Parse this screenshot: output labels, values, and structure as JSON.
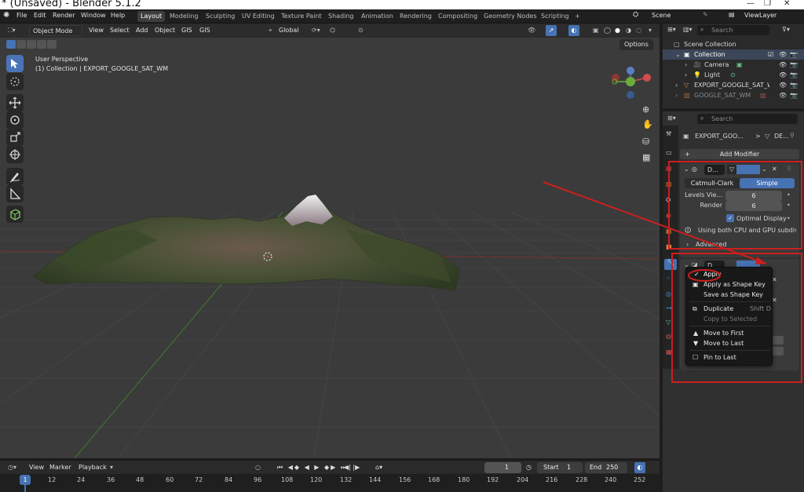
{
  "app": {
    "window_title": "* (Unsaved) - Blender 5.1.2",
    "menu": [
      "File",
      "Edit",
      "Render",
      "Window",
      "Help"
    ],
    "workspaces": [
      "Layout",
      "Modeling",
      "Sculpting",
      "UV Editing",
      "Texture Paint",
      "Shading",
      "Animation",
      "Rendering",
      "Compositing",
      "Geometry Nodes",
      "Scripting"
    ],
    "active_workspace": "Layout",
    "add_workspace": "+",
    "scene": "Scene",
    "view_layer": "ViewLayer"
  },
  "viewport": {
    "header": {
      "mode": "Object Mode",
      "menus": [
        "View",
        "Select",
        "Add",
        "Object",
        "GIS",
        "GIS"
      ],
      "orientation": "Global",
      "options": "Options"
    },
    "overlay_text": {
      "perspective": "User Perspective",
      "collection": "(1) Collection | EXPORT_GOOGLE_SAT_WM"
    }
  },
  "timeline": {
    "menus": [
      "View",
      "Marker",
      "Playback"
    ],
    "current_frame": "1",
    "start_label": "Start",
    "start": "1",
    "end_label": "End",
    "end": "250",
    "ticks": [
      "1",
      "12",
      "24",
      "36",
      "48",
      "60",
      "72",
      "84",
      "96",
      "108",
      "120",
      "132",
      "144",
      "156",
      "168",
      "180",
      "192",
      "204",
      "216",
      "228",
      "240",
      "252"
    ]
  },
  "outliner": {
    "search_placeholder": "Search",
    "items": [
      {
        "label": "Scene Collection"
      },
      {
        "label": "Collection"
      },
      {
        "label": "Camera"
      },
      {
        "label": "Light"
      },
      {
        "label": "EXPORT_GOOGLE_SAT_W"
      },
      {
        "label": "GOOGLE_SAT_WM"
      }
    ]
  },
  "properties": {
    "search_placeholder": "Search",
    "breadcrumb_object": "EXPORT_GOO...",
    "breadcrumb_sep": ">",
    "breadcrumb_data": "DE...",
    "add_modifier": "Add Modifier",
    "modifier1": {
      "name": "D...",
      "mode_catmull": "Catmull-Clark",
      "mode_simple": "Simple",
      "levels_label": "Levels Vie...",
      "levels_value": "6",
      "render_label": "Render",
      "render_value": "6",
      "optimal_display": "Optimal Display",
      "warning": "Using both CPU and GPU subdiv...",
      "advanced": "Advanced"
    },
    "modifier2": {
      "name": "D..."
    }
  },
  "context_menu": {
    "items": [
      {
        "label": "Apply",
        "shortcut": ""
      },
      {
        "label": "Apply as Shape Key",
        "shortcut": ""
      },
      {
        "label": "Save as Shape Key",
        "shortcut": ""
      },
      {
        "label": "Duplicate",
        "shortcut": "Shift D"
      },
      {
        "label": "Copy to Selected",
        "shortcut": ""
      },
      {
        "label": "Move to First",
        "shortcut": ""
      },
      {
        "label": "Move to Last",
        "shortcut": ""
      },
      {
        "label": "Pin to Last",
        "shortcut": ""
      }
    ]
  },
  "colors": {
    "accent_blue": "#4772b3",
    "annotation_red": "#cc1f1f",
    "viewport_bg": "#3b3b3b"
  }
}
